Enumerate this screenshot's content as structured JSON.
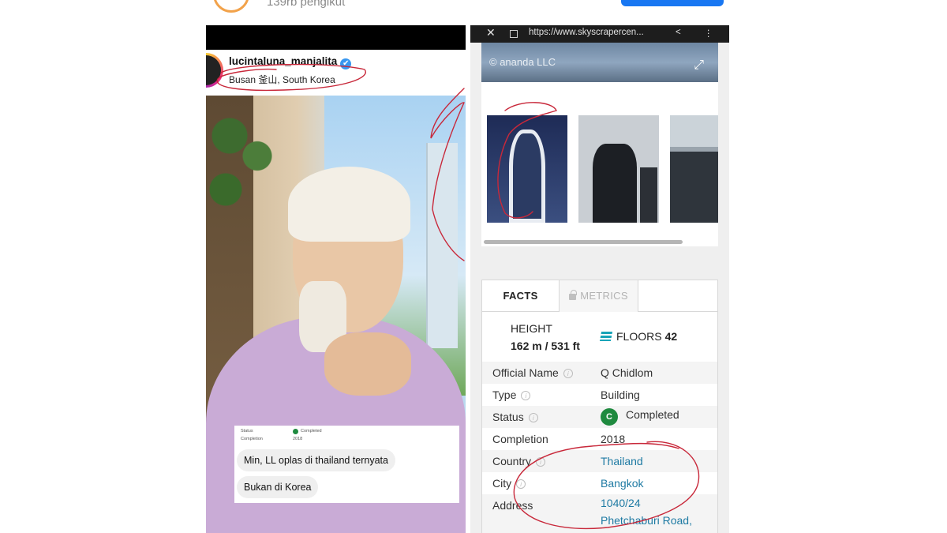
{
  "profile": {
    "followers": "139rb pengikut"
  },
  "instagram": {
    "username": "lucintaluna_manjalita",
    "verified_mark": "✔",
    "location": "Busan 釜山, South Korea"
  },
  "chat": {
    "mini_status_label": "Status",
    "mini_status_value": "Completed",
    "mini_completion_label": "Completion",
    "mini_completion_value": "2018",
    "messages": [
      "Min, LL oplas di thailand ternyata",
      "Bukan di Korea"
    ]
  },
  "browser": {
    "url": "https://www.skyscrapercen..."
  },
  "gallery": {
    "credit": "© ananda LLC"
  },
  "tabs": {
    "facts": "FACTS",
    "metrics": "METRICS"
  },
  "facts": {
    "height_label": "HEIGHT",
    "height_value": "162 m / 531 ft",
    "floors_label": "FLOORS",
    "floors_value": "42",
    "rows": [
      {
        "key": "Official Name",
        "value": "Q Chidlom"
      },
      {
        "key": "Type",
        "value": "Building"
      },
      {
        "key": "Status",
        "value": "Completed",
        "badge": "C"
      },
      {
        "key": "Completion",
        "value": "2018"
      },
      {
        "key": "Country",
        "value": "Thailand"
      },
      {
        "key": "City",
        "value": "Bangkok"
      },
      {
        "key": "Address",
        "value": "1040/24",
        "value2": "Phetchaburi Road,"
      }
    ]
  },
  "colors": {
    "status_green": "#1f8a3f",
    "link_blue": "#1e7aa3",
    "annotation_red": "#c8283a",
    "verified_blue": "#3897f0"
  },
  "icons": [
    "close-icon",
    "lock-icon",
    "share-icon",
    "more-icon",
    "expand-icon",
    "floors-stack-icon",
    "info-icon",
    "padlock-icon",
    "verified-icon"
  ]
}
